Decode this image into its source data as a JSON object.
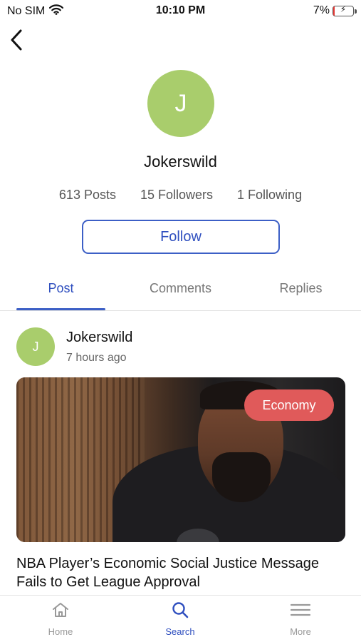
{
  "status_bar": {
    "carrier": "No SIM",
    "time": "10:10 PM",
    "battery_percent": "7%",
    "battery_level": 0.07,
    "wifi_icon": "wifi-icon",
    "battery_icon": "battery-charging-icon"
  },
  "profile": {
    "avatar_initial": "J",
    "avatar_color": "#a9cd6c",
    "name": "Jokerswild",
    "posts": "613 Posts",
    "followers": "15 Followers",
    "following": "1 Following",
    "follow_label": "Follow"
  },
  "tabs": [
    {
      "label": "Post",
      "active": true
    },
    {
      "label": "Comments",
      "active": false
    },
    {
      "label": "Replies",
      "active": false
    }
  ],
  "post": {
    "avatar_initial": "J",
    "author": "Jokerswild",
    "time": "7 hours ago",
    "category": "Economy",
    "category_color": "#e05a5a",
    "title": "NBA Player’s Economic Social Justice Message Fails to Get League Approval"
  },
  "bottom_nav": [
    {
      "label": "Home",
      "icon": "home-icon",
      "active": false
    },
    {
      "label": "Search",
      "icon": "search-icon",
      "active": true
    },
    {
      "label": "More",
      "icon": "menu-icon",
      "active": false
    }
  ],
  "colors": {
    "accent": "#2f4fbf",
    "muted_text": "#777777"
  }
}
